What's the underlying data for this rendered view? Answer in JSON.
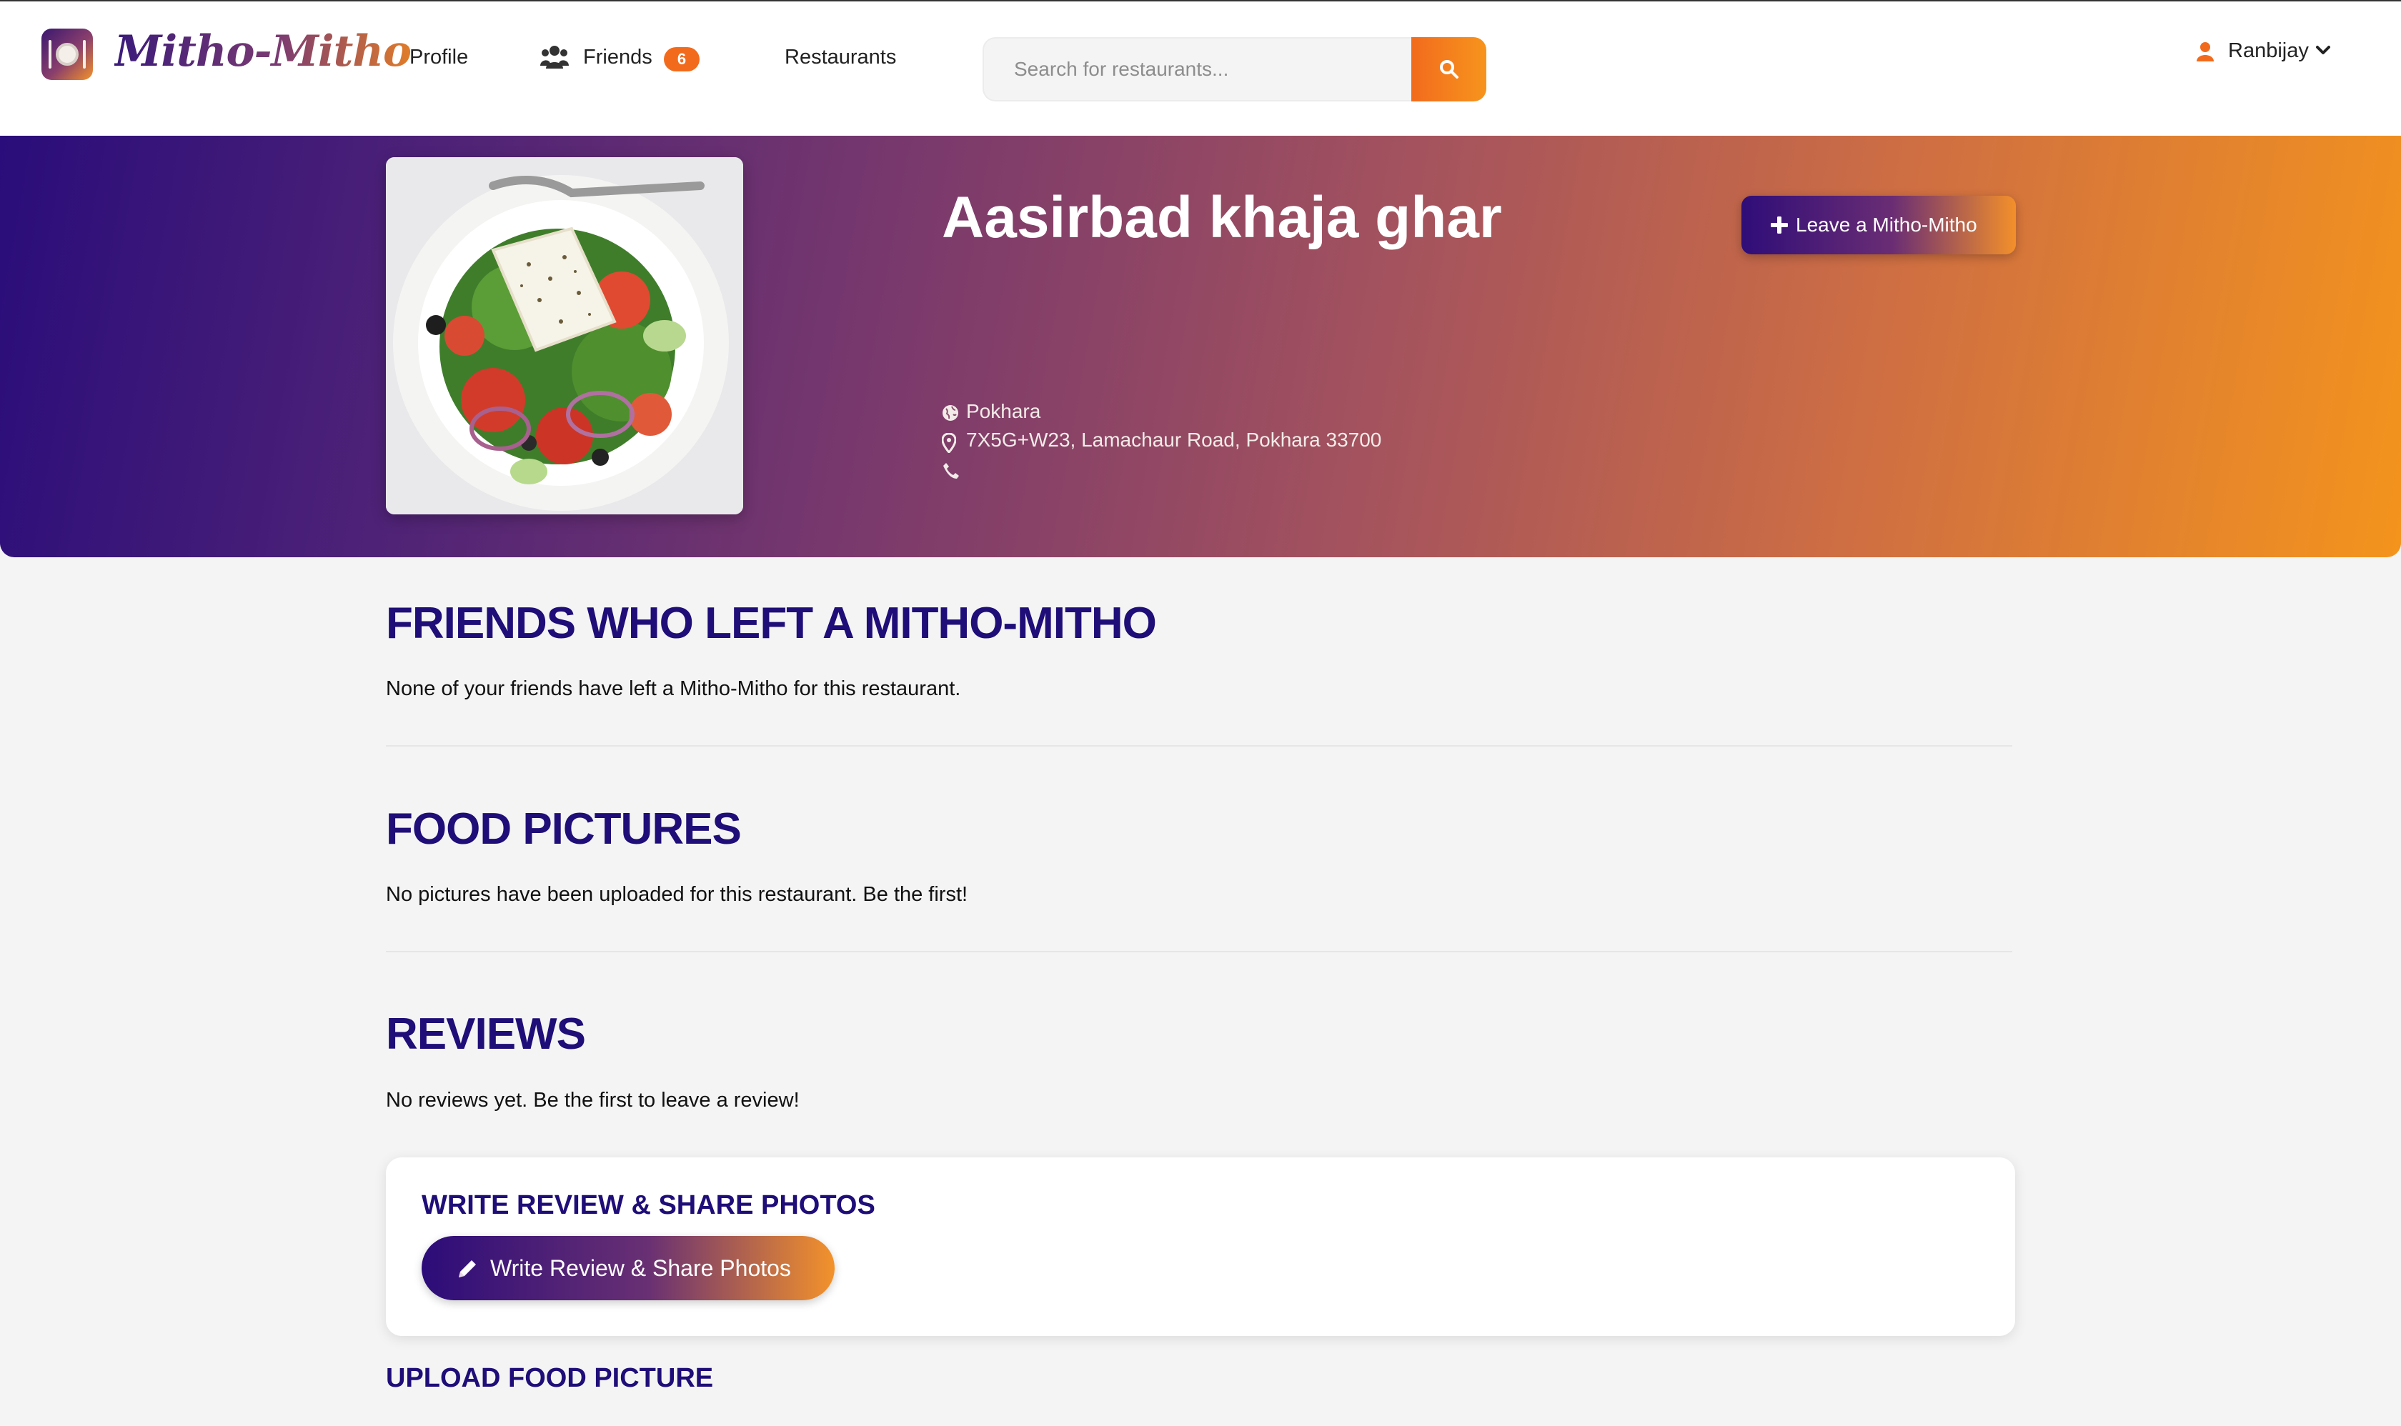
{
  "navbar": {
    "brand": "Mitho-Mitho",
    "links": {
      "profile": "Profile",
      "friends": "Friends",
      "friends_count": "6",
      "restaurants": "Restaurants"
    },
    "search": {
      "placeholder": "Search for restaurants...",
      "value": ""
    },
    "user": {
      "name": "Ranbijay"
    }
  },
  "restaurant": {
    "name": "Aasirbad khaja ghar",
    "city": "Pokhara",
    "address": "7X5G+W23, Lamachaur Road, Pokhara 33700",
    "phone": "",
    "leave_button": "Leave a Mitho-Mitho"
  },
  "sections": {
    "friends": {
      "title": "FRIENDS WHO LEFT A MITHO-MITHO",
      "empty_text": "None of your friends have left a Mitho-Mitho for this restaurant."
    },
    "food_pictures": {
      "title": "FOOD PICTURES",
      "empty_text": "No pictures have been uploaded for this restaurant. Be the first!"
    },
    "reviews": {
      "title": "REVIEWS",
      "empty_text": "No reviews yet. Be the first to leave a review!"
    },
    "write_review": {
      "title": "WRITE REVIEW & SHARE PHOTOS",
      "button": "Write Review & Share Photos"
    },
    "upload": {
      "title": "UPLOAD FOOD PICTURE"
    }
  },
  "colors": {
    "accent_orange": "#f26b1d",
    "heading_navy": "#1f0d78",
    "hero_gradient_start": "#2a0d7a",
    "hero_gradient_end": "#f4941c"
  },
  "icons": {
    "brand": "plate-cutlery-icon",
    "friends": "users-icon",
    "search": "search-icon",
    "user": "user-icon",
    "dropdown": "chevron-down-icon",
    "city": "globe-icon",
    "address": "map-marker-icon",
    "phone": "phone-icon",
    "leave": "plus-icon",
    "write": "pencil-icon"
  }
}
